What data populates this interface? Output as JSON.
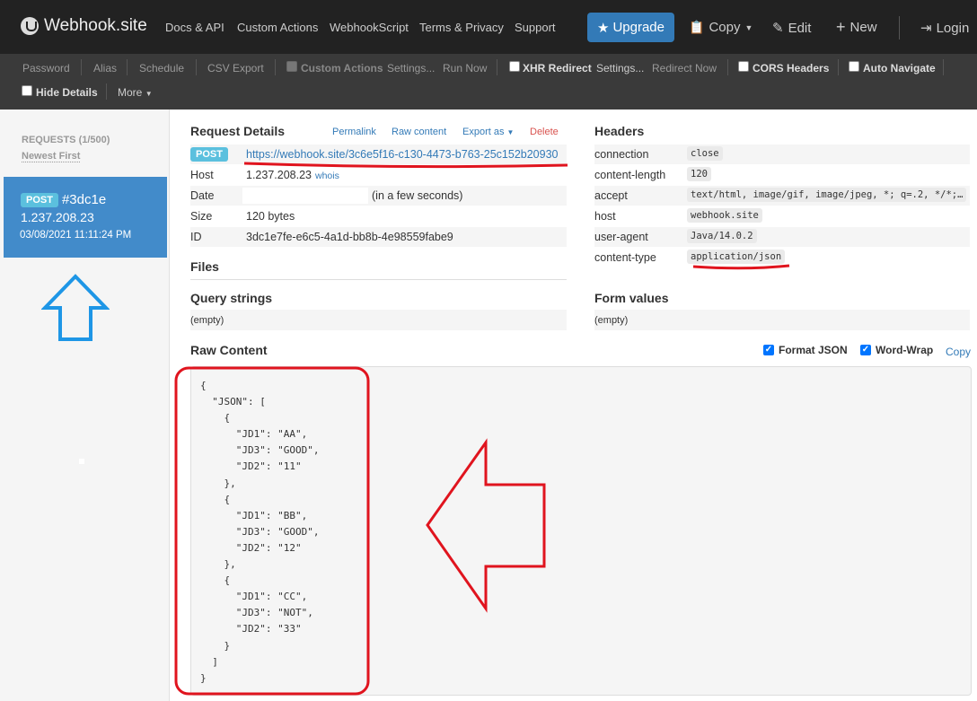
{
  "nav": {
    "brand": "Webhook.site",
    "links": [
      "Docs & API",
      "Custom Actions",
      "WebhookScript",
      "Terms & Privacy",
      "Support"
    ],
    "upgrade": "Upgrade",
    "copy": "Copy",
    "edit": "Edit",
    "new": "New",
    "login": "Login"
  },
  "toolbar": {
    "password": "Password",
    "alias": "Alias",
    "schedule": "Schedule",
    "csv_export": "CSV Export",
    "custom_actions": "Custom Actions",
    "settings1": "Settings...",
    "run_now": "Run Now",
    "xhr_redirect": "XHR Redirect",
    "settings2": "Settings...",
    "redirect_now": "Redirect Now",
    "cors_headers": "CORS Headers",
    "auto_navigate": "Auto Navigate",
    "hide_details": "Hide Details",
    "more": "More"
  },
  "sidebar": {
    "requests_count": "REQUESTS (1/500)",
    "newest_first": "Newest First",
    "item": {
      "method": "POST",
      "id": "#3dc1e",
      "ip": "1.237.208.23",
      "time": "03/08/2021 11:11:24 PM"
    }
  },
  "request": {
    "title": "Request Details",
    "permalink": "Permalink",
    "raw_content": "Raw content",
    "export_as": "Export as",
    "delete": "Delete",
    "method": "POST",
    "url": "https://webhook.site/3c6e5f16-c130-4473-b763-25c152b20930",
    "host_label": "Host",
    "host": "1.237.208.23",
    "whois": "whois",
    "date_label": "Date",
    "date_rel": "(in a few seconds)",
    "size_label": "Size",
    "size": "120 bytes",
    "id_label": "ID",
    "id": "3dc1e7fe-e6c5-4a1d-bb8b-4e98559fabe9"
  },
  "files_title": "Files",
  "query": {
    "title": "Query strings",
    "value": "(empty)"
  },
  "headers": {
    "title": "Headers",
    "items": [
      {
        "key": "connection",
        "value": "close"
      },
      {
        "key": "content-length",
        "value": "120"
      },
      {
        "key": "accept",
        "value": "text/html, image/gif, image/jpeg, *; q=.2, */*;…"
      },
      {
        "key": "host",
        "value": "webhook.site"
      },
      {
        "key": "user-agent",
        "value": "Java/14.0.2"
      },
      {
        "key": "content-type",
        "value": "application/json"
      }
    ]
  },
  "form": {
    "title": "Form values",
    "value": "(empty)"
  },
  "raw": {
    "title": "Raw Content",
    "format_json": "Format JSON",
    "word_wrap": "Word-Wrap",
    "copy": "Copy",
    "content": "{\n  \"JSON\": [\n    {\n      \"JD1\": \"AA\",\n      \"JD3\": \"GOOD\",\n      \"JD2\": \"11\"\n    },\n    {\n      \"JD1\": \"BB\",\n      \"JD3\": \"GOOD\",\n      \"JD2\": \"12\"\n    },\n    {\n      \"JD1\": \"CC\",\n      \"JD3\": \"NOT\",\n      \"JD2\": \"33\"\n    }\n  ]\n}"
  },
  "colors": {
    "navbar": "#222222",
    "toolbar": "#3a3a3a",
    "accent": "#337ab7",
    "selected": "#428bca",
    "annotation_red": "#e0141e",
    "annotation_blue": "#1e96e6"
  }
}
